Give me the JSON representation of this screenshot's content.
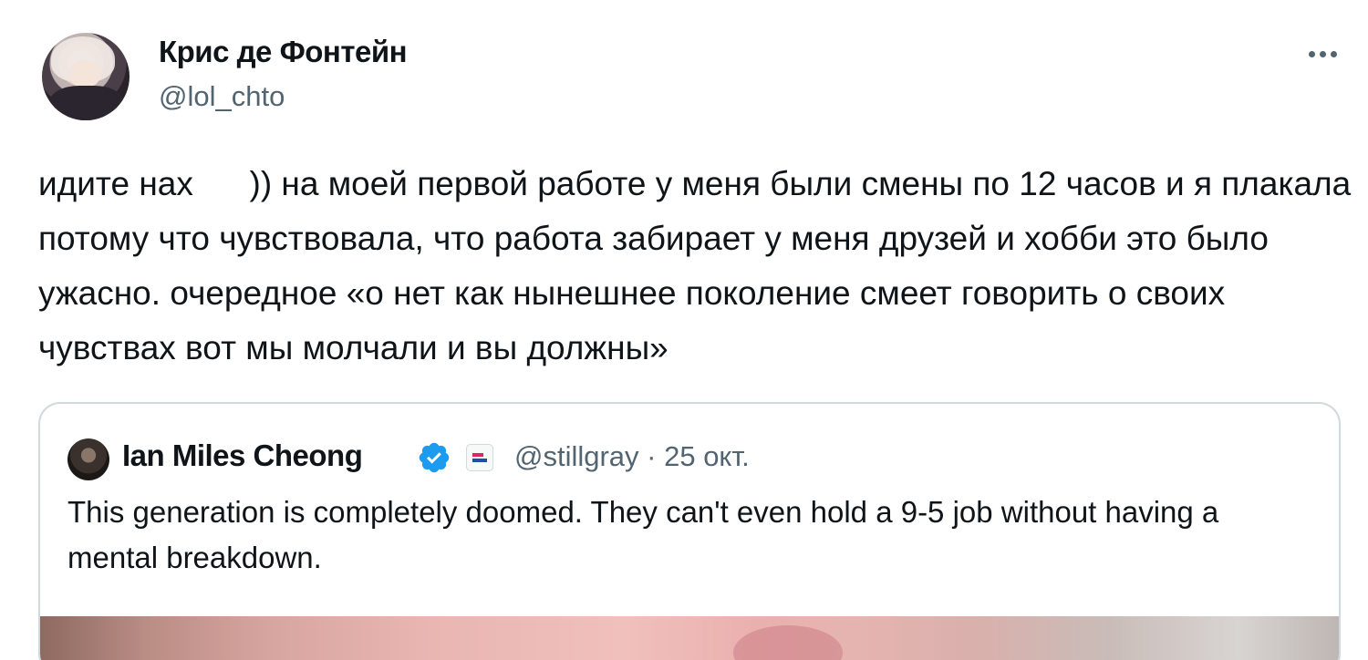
{
  "author": {
    "name": "Крис де Фонтейн",
    "handle": "@lol_chto",
    "avatar_icon": "profile-avatar"
  },
  "more_icon": "more-horizontal-icon",
  "tweet": {
    "text": "идите нах      )) на моей первой работе у меня были смены по 12 часов и я плакала потому что чувствовала, что работа забирает у меня друзей и хобби это было ужасно. очередное «о нет как нынешнее поколение смеет говорить о своих чувствах вот мы молчали и вы должны»"
  },
  "quoted_tweet": {
    "author_name": "Ian Miles Cheong",
    "verified_icon": "verified-badge-icon",
    "affiliate_icon": "affiliate-badge-icon",
    "handle_date": "@stillgray · 25 окт.",
    "text": "This generation is completely doomed. They can't even hold a 9-5 job without having a mental breakdown."
  },
  "colors": {
    "text_primary": "#0f1419",
    "text_secondary": "#536471",
    "border": "#cfd9de",
    "verified_blue": "#1d9bf0"
  }
}
